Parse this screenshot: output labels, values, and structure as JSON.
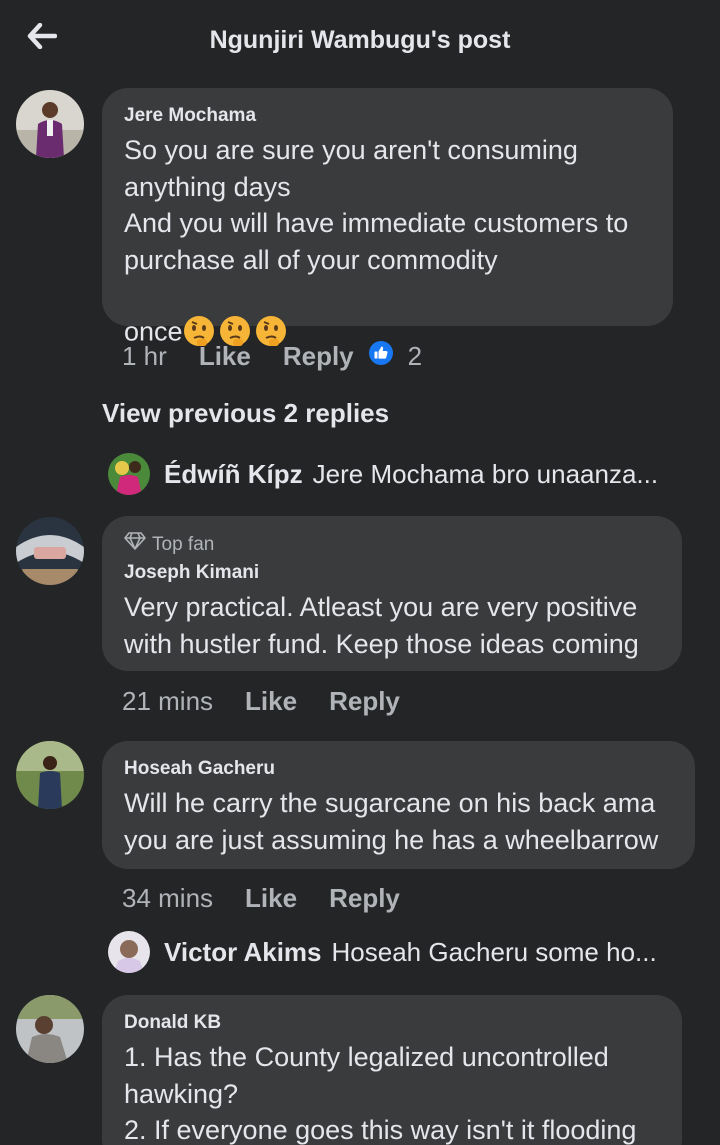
{
  "header": {
    "title": "Ngunjiri Wambugu's post"
  },
  "comments": [
    {
      "author": "Jere Mochama",
      "text": "So you are sure you aren't consuming\nanything days\nAnd you will have immediate customers to\npurchase all of your commodity\nonce",
      "emojis": [
        "thinking-face-emoji",
        "thinking-face-emoji",
        "thinking-face-emoji"
      ],
      "time": "1 hr",
      "like_label": "Like",
      "reply_label": "Reply",
      "reaction_count": "2"
    },
    {
      "badge": "Top fan",
      "author": "Joseph Kimani",
      "text": "Very practical. Atleast you are very positive\nwith hustler fund. Keep those ideas coming",
      "time": "21 mins",
      "like_label": "Like",
      "reply_label": "Reply"
    },
    {
      "author": "Hoseah Gacheru",
      "text": "Will he carry the sugarcane on his back ama\nyou are just assuming he has a wheelbarrow",
      "time": "34 mins",
      "like_label": "Like",
      "reply_label": "Reply"
    },
    {
      "author": "Donald KB",
      "text": "1. Has the County legalized uncontrolled\nhawking?\n2. If everyone goes this way isn't it flooding"
    }
  ],
  "view_previous": "View previous 2 replies",
  "replies": [
    {
      "name": "Édwíñ Kípz",
      "text": "Jere Mochama bro unaanza..."
    },
    {
      "name": "Victor Akims",
      "text": "Hoseah Gacheru some ho..."
    }
  ],
  "colors": {
    "background": "#242526",
    "bubble": "#3a3b3c",
    "text": "#e4e6eb",
    "secondary_text": "#b0b3b8",
    "like_blue": "#1877f2"
  }
}
